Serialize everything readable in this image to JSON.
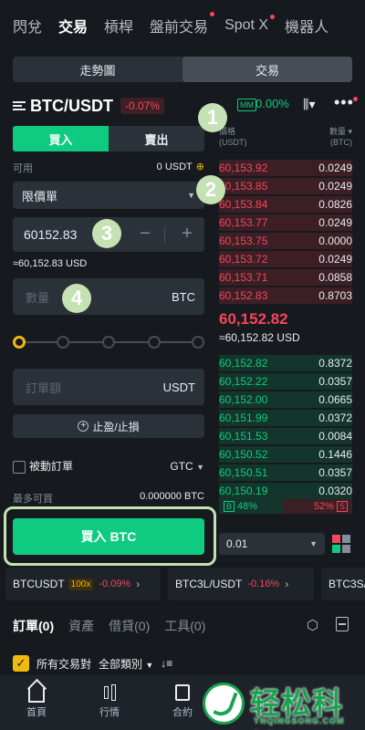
{
  "topnav": {
    "tabs": [
      {
        "label": "閃兌"
      },
      {
        "label": "交易"
      },
      {
        "label": "槓桿"
      },
      {
        "label": "盤前交易"
      },
      {
        "label": "Spot X"
      },
      {
        "label": "機器人"
      }
    ]
  },
  "segment": {
    "chart": "走勢圖",
    "trade": "交易"
  },
  "pair": {
    "symbol": "BTC/USDT",
    "change": "-0.07%",
    "mm_label": "MM",
    "mm_value": "0.00%"
  },
  "form": {
    "buy_label": "買入",
    "sell_label": "賣出",
    "available_label": "可用",
    "available_value": "0 USDT",
    "order_type": "限價單",
    "price_value": "60152.83",
    "price_usd": "≈60,152.83 USD",
    "qty_placeholder": "數量",
    "qty_unit": "BTC",
    "amount_placeholder": "訂單額",
    "amount_unit": "USDT",
    "tpsl_label": "止盈/止損",
    "passive_label": "被動訂單",
    "tif": "GTC",
    "max_label": "最多可買",
    "max_value": "0.000000 BTC",
    "submit_label": "買入 BTC",
    "slider_percent": 0
  },
  "orderbook": {
    "price_header_1": "價格",
    "price_header_2": "(USDT)",
    "qty_header_1": "數量",
    "qty_header_2": "(BTC)",
    "asks": [
      {
        "price": "60,153.92",
        "qty": "0.0249"
      },
      {
        "price": "60,153.85",
        "qty": "0.0249"
      },
      {
        "price": "60,153.84",
        "qty": "0.0826"
      },
      {
        "price": "60,153.77",
        "qty": "0.0249"
      },
      {
        "price": "60,153.75",
        "qty": "0.0000"
      },
      {
        "price": "60,153.72",
        "qty": "0.0249"
      },
      {
        "price": "60,153.71",
        "qty": "0.0858"
      },
      {
        "price": "60,152.83",
        "qty": "0.8703"
      }
    ],
    "mid_price": "60,152.82",
    "mid_usd": "≈60,152.82 USD",
    "bids": [
      {
        "price": "60,152.82",
        "qty": "0.8372"
      },
      {
        "price": "60,152.22",
        "qty": "0.0357"
      },
      {
        "price": "60,152.00",
        "qty": "0.0665"
      },
      {
        "price": "60,151.99",
        "qty": "0.0372"
      },
      {
        "price": "60,151.53",
        "qty": "0.0084"
      },
      {
        "price": "60,150.52",
        "qty": "0.1446"
      },
      {
        "price": "60,150.51",
        "qty": "0.0357"
      },
      {
        "price": "60,150.19",
        "qty": "0.0320"
      }
    ],
    "buy_tag": "B",
    "buy_ratio": "48%",
    "sell_ratio": "52%",
    "sell_tag": "S",
    "depth": "0.01"
  },
  "tickers": [
    {
      "symbol": "BTCUSDT",
      "leverage": "100x",
      "change": "-0.09%"
    },
    {
      "symbol": "BTC3L/USDT",
      "leverage": "",
      "change": "-0.16%"
    },
    {
      "symbol": "BTC3S/",
      "leverage": "",
      "change": ""
    }
  ],
  "orders": {
    "tabs": [
      {
        "label": "訂單(0)"
      },
      {
        "label": "資產"
      },
      {
        "label": "借貸(0)"
      },
      {
        "label": "工具(0)"
      }
    ],
    "filter_all_pairs": "所有交易對",
    "filter_category": "全部類別"
  },
  "bottomnav": [
    {
      "label": "首頁"
    },
    {
      "label": "行情"
    },
    {
      "label": "合約"
    }
  ],
  "badges": [
    "1",
    "2",
    "3",
    "4"
  ],
  "watermark": {
    "text": "轻松科技",
    "sub": "YNQINGSONG.COM"
  },
  "colors": {
    "bg": "#161a1e",
    "green": "#0ecb81",
    "red": "#f6465d",
    "yellow": "#f0b90b",
    "badge": "#c4e2b3"
  }
}
